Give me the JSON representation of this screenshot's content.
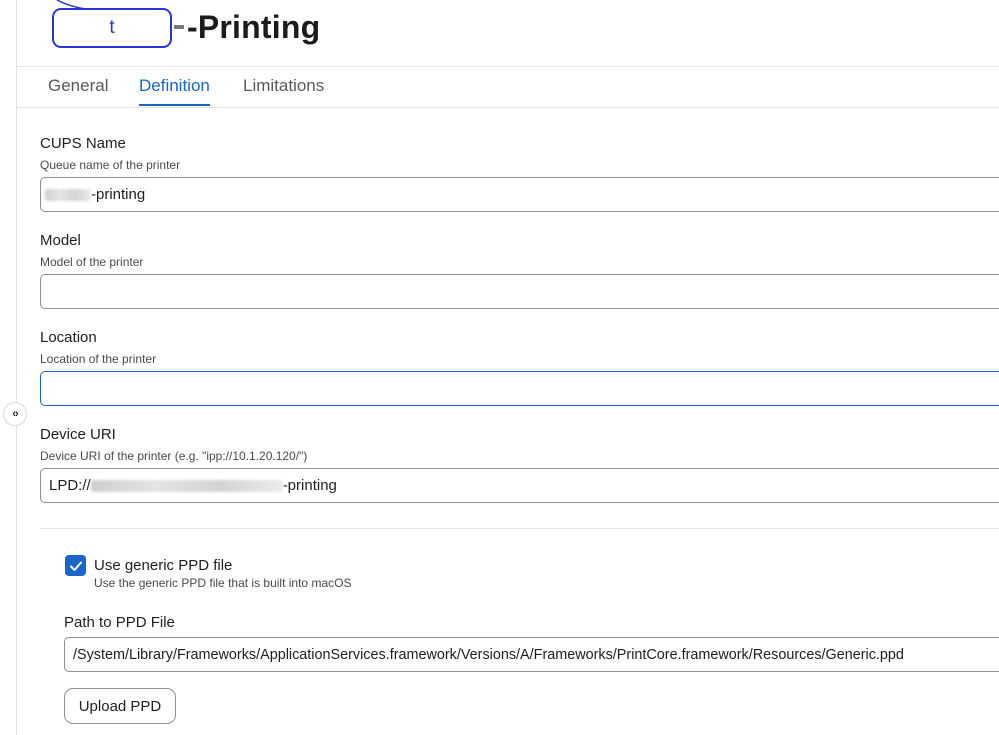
{
  "header": {
    "title": "-Printing",
    "redaction_mark": "t"
  },
  "tabs": [
    {
      "label": "General",
      "active": false
    },
    {
      "label": "Definition",
      "active": true
    },
    {
      "label": "Limitations",
      "active": false
    }
  ],
  "fields": {
    "cups_name": {
      "label": "CUPS Name",
      "help": "Queue name of the printer",
      "value_suffix": "-printing"
    },
    "model": {
      "label": "Model",
      "help": "Model of the printer",
      "value": ""
    },
    "location": {
      "label": "Location",
      "help": "Location of the printer",
      "value": ""
    },
    "device_uri": {
      "label": "Device URI",
      "help": "Device URI of the printer (e.g. \"ipp://10.1.20.120/\")",
      "value_prefix": "LPD://",
      "value_suffix": "-printing"
    }
  },
  "generic_ppd": {
    "checked": true,
    "label": "Use generic PPD file",
    "help": "Use the generic PPD file that is built into macOS"
  },
  "ppd_path": {
    "label": "Path to PPD File",
    "value": "/System/Library/Frameworks/ApplicationServices.framework/Versions/A/Frameworks/PrintCore.framework/Resources/Generic.ppd"
  },
  "upload_button": {
    "label": "Upload PPD"
  },
  "colors": {
    "accent": "#1a66c8",
    "annotation": "#2a35d6"
  }
}
